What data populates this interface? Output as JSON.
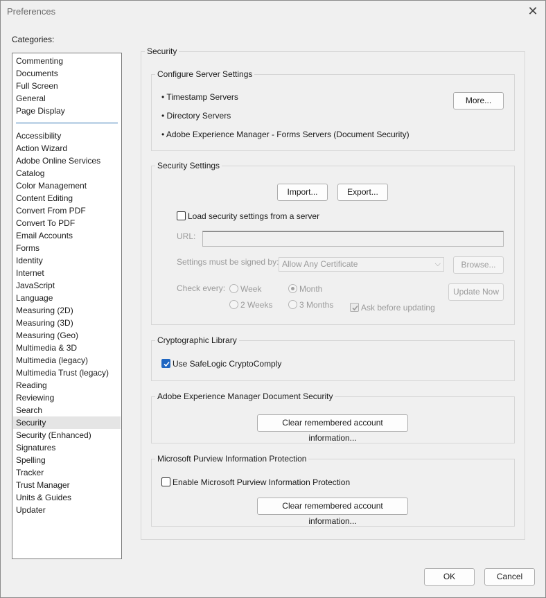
{
  "window": {
    "title": "Preferences"
  },
  "categories": {
    "label": "Categories:",
    "top_items": [
      "Commenting",
      "Documents",
      "Full Screen",
      "General",
      "Page Display"
    ],
    "items": [
      "Accessibility",
      "Action Wizard",
      "Adobe Online Services",
      "Catalog",
      "Color Management",
      "Content Editing",
      "Convert From PDF",
      "Convert To PDF",
      "Email Accounts",
      "Forms",
      "Identity",
      "Internet",
      "JavaScript",
      "Language",
      "Measuring (2D)",
      "Measuring (3D)",
      "Measuring (Geo)",
      "Multimedia & 3D",
      "Multimedia (legacy)",
      "Multimedia Trust (legacy)",
      "Reading",
      "Reviewing",
      "Search",
      "Security",
      "Security (Enhanced)",
      "Signatures",
      "Spelling",
      "Tracker",
      "Trust Manager",
      "Units & Guides",
      "Updater"
    ],
    "selected": "Security"
  },
  "panel": {
    "title": "Security",
    "server": {
      "title": "Configure Server Settings",
      "items": [
        "• Timestamp Servers",
        "• Directory Servers",
        "• Adobe Experience Manager - Forms Servers (Document Security)"
      ],
      "more_button": "More..."
    },
    "security_settings": {
      "title": "Security Settings",
      "import_button": "Import...",
      "export_button": "Export...",
      "load_checkbox_label": "Load security settings from a server",
      "load_checked": false,
      "url_label": "URL:",
      "url_value": "",
      "signed_label": "Settings must be signed by:",
      "signed_value": "Allow Any Certificate",
      "browse_button": "Browse...",
      "check_every_label": "Check every:",
      "radio_week": "Week",
      "radio_2weeks": "2 Weeks",
      "radio_month": "Month",
      "radio_3months": "3 Months",
      "ask_label": "Ask before updating",
      "update_button": "Update Now"
    },
    "crypto": {
      "title": "Cryptographic Library",
      "checkbox_label": "Use SafeLogic CryptoComply",
      "checked": true
    },
    "aem": {
      "title": "Adobe Experience Manager Document Security",
      "clear_button": "Clear remembered account information..."
    },
    "purview": {
      "title": "Microsoft Purview Information Protection",
      "checkbox_label": "Enable Microsoft Purview Information Protection",
      "checked": false,
      "clear_button": "Clear remembered account information..."
    }
  },
  "footer": {
    "ok_button": "OK",
    "cancel_button": "Cancel"
  },
  "colors": {
    "accent": "#1f66c1",
    "separator": "#2a6fb0",
    "selection": "#e5e5e5"
  }
}
